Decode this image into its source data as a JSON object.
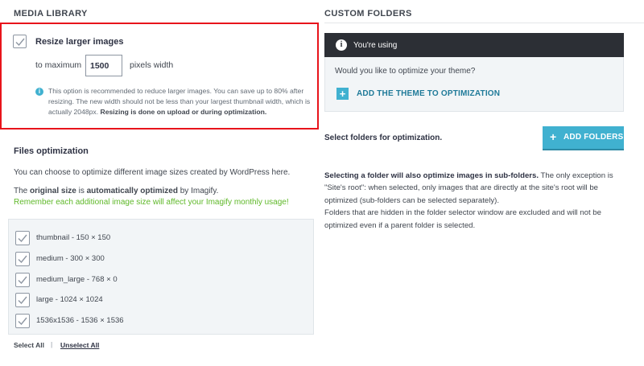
{
  "media_library": {
    "title": "MEDIA LIBRARY",
    "resize": {
      "label": "Resize larger images",
      "checked": true,
      "to_maximum": "to maximum",
      "value": "1500",
      "unit": "pixels width",
      "info_line1": "This option is recommended to reduce larger images. You can save up to 80% after",
      "info_line2": "resizing. The new width should not be less than your largest thumbnail width, which is",
      "info_line3_prefix": "actually 2048px.",
      "info_line3_bold": "Resizing is done on upload or during optimization."
    }
  },
  "files_optimization": {
    "title": "Files optimization",
    "line1": "You can choose to optimize different image sizes created by WordPress here.",
    "line2_part1": "The",
    "line2_bold1": "original size",
    "line2_part2": "is",
    "line2_bold2": "automatically optimized",
    "line2_part3": "by Imagify.",
    "line3": "Remember each additional image size will affect your Imagify monthly usage!",
    "sizes": [
      {
        "label": "thumbnail - 150 × 150",
        "checked": true
      },
      {
        "label": "medium - 300 × 300",
        "checked": true
      },
      {
        "label": "medium_large - 768 × 0",
        "checked": true
      },
      {
        "label": "large - 1024 × 1024",
        "checked": true
      },
      {
        "label": "1536x1536 - 1536 × 1536",
        "checked": true
      }
    ],
    "select_all": "Select All",
    "separator": "|",
    "unselect_all": "Unselect All"
  },
  "custom_folders": {
    "title": "CUSTOM FOLDERS",
    "notice_title": "You're using",
    "notice_question": "Would you like to optimize your theme?",
    "add_theme": "ADD THE THEME TO OPTIMIZATION",
    "select_label": "Select folders for optimization.",
    "add_folders": "ADD FOLDERS",
    "desc_bold": "Selecting a folder will also optimize images in sub-folders.",
    "desc_line1_rest": "The only exception is",
    "desc_line2": "\"Site's root\": when selected, only images that are directly at the site's root will be",
    "desc_line3": "optimized (sub-folders can be selected separately).",
    "desc_line4": "Folders that are hidden in the folder selector window are excluded and will not be",
    "desc_line5": "optimized even if a parent folder is selected."
  },
  "colors": {
    "accent": "#40b1d0",
    "highlight_border": "#e8141b",
    "green_text": "#5fb829",
    "dark_notice": "#2c2f35"
  },
  "icons": [
    "checkmark-icon",
    "info-icon",
    "plus-icon"
  ]
}
